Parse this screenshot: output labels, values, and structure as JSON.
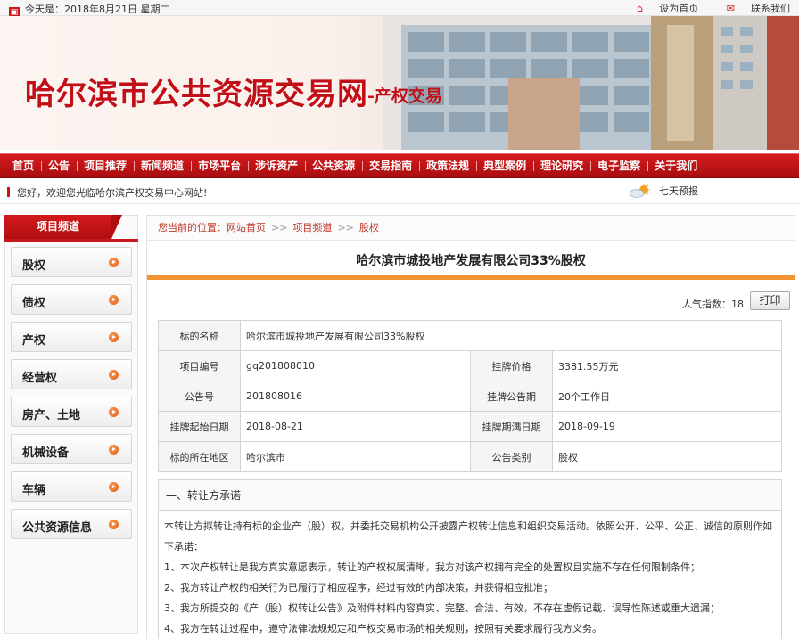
{
  "topbar": {
    "date": "今天是：2018年8月21日 星期二",
    "set_home": "设为首页",
    "contact": "联系我们"
  },
  "banner": {
    "title": "哈尔滨市公共资源交易网",
    "subtitle": "-产权交易"
  },
  "nav": [
    "首页",
    "公告",
    "项目推荐",
    "新闻频道",
    "市场平台",
    "涉诉资产",
    "公共资源",
    "交易指南",
    "政策法规",
    "典型案例",
    "理论研究",
    "电子监察",
    "关于我们"
  ],
  "welcome": {
    "message": "您好，欢迎您光临哈尔滨产权交易中心网站!",
    "weather": "七天预报"
  },
  "sidebar": {
    "heading": "项目频道",
    "items": [
      "股权",
      "债权",
      "产权",
      "经营权",
      "房产、土地",
      "机械设备",
      "车辆",
      "公共资源信息"
    ]
  },
  "breadcrumb": {
    "label": "您当前的位置：",
    "items": [
      "网站首页",
      "项目频道",
      "股权"
    ],
    "sep": ">>"
  },
  "detail": {
    "title": "哈尔滨市城投地产发展有限公司33%股权",
    "popularity_label": "人气指数：",
    "popularity_value": "18",
    "print_label": "打印",
    "rows": [
      {
        "k1": "标的名称",
        "v1": "哈尔滨市城投地产发展有限公司33%股权"
      },
      {
        "k1": "项目编号",
        "v1": "gq201808010",
        "k2": "挂牌价格",
        "v2": "3381.55万元"
      },
      {
        "k1": "公告号",
        "v1": "201808016",
        "k2": "挂牌公告期",
        "v2": "20个工作日"
      },
      {
        "k1": "挂牌起始日期",
        "v1": "2018-08-21",
        "k2": "挂牌期满日期",
        "v2": "2018-09-19"
      },
      {
        "k1": "标的所在地区",
        "v1": "哈尔滨市",
        "k2": "公告类别",
        "v2": "股权"
      }
    ]
  },
  "promise": {
    "heading": "一、转让方承诺",
    "intro": "本转让方拟转让持有标的企业产（股）权，并委托交易机构公开披露产权转让信息和组织交易活动。依照公开、公平、公正、诚信的原则作如下承诺：",
    "items": [
      "1、本次产权转让是我方真实意愿表示，转让的产权权属清晰，我方对该产权拥有完全的处置权且实施不存在任何限制条件；",
      "2、我方转让产权的相关行为已履行了相应程序，经过有效的内部决策，并获得相应批准；",
      "3、我方所提交的《产（股）权转让公告》及附件材料内容真实、完整、合法、有效，不存在虚假记载、误导性陈述或重大遗漏；",
      "4、我方在转让过程中，遵守法律法规规定和产权交易市场的相关规则，按照有关要求履行我方义务。"
    ]
  },
  "colors": {
    "brand_red": "#c9171e",
    "accent_orange": "#f39430"
  }
}
